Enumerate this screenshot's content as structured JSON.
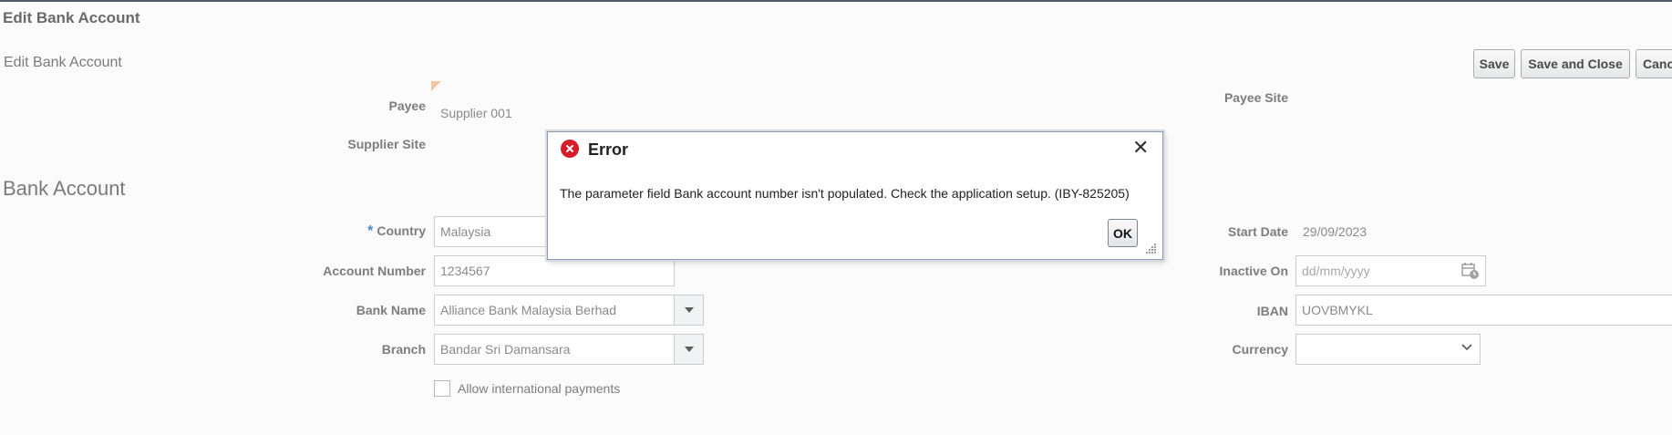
{
  "page": {
    "title": "Edit Bank Account",
    "subtitle": "Edit Bank Account"
  },
  "toolbar": {
    "save_label": "Save",
    "save_close_label": "Save and Close",
    "cancel_label": "Canc"
  },
  "payee": {
    "payee_label": "Payee",
    "payee_value": "Supplier 001",
    "supplier_site_label": "Supplier Site",
    "payee_site_label": "Payee Site"
  },
  "bank_account": {
    "section_title": "Bank Account",
    "required_marker": "*",
    "country_label": "Country",
    "country_value": "Malaysia",
    "account_number_label": "Account Number",
    "account_number_value": "1234567",
    "bank_name_label": "Bank Name",
    "bank_name_value": "Alliance Bank Malaysia Berhad",
    "branch_label": "Branch",
    "branch_value": "Bandar Sri Damansara",
    "allow_international_label": "Allow international payments",
    "start_date_label": "Start Date",
    "start_date_value": "29/09/2023",
    "inactive_on_label": "Inactive On",
    "inactive_on_placeholder": "dd/mm/yyyy",
    "iban_label": "IBAN",
    "iban_value": "UOVBMYKL",
    "currency_label": "Currency",
    "currency_value": ""
  },
  "dialog": {
    "title": "Error",
    "message": "The parameter field Bank account number isn't populated. Check the application setup. (IBY-825205)",
    "ok_label": "OK"
  },
  "icons": {
    "error": "error-circle-icon",
    "close": "close-icon",
    "calendar": "calendar-icon",
    "dropdown": "chevron-down-icon",
    "resize": "resize-grip-icon"
  },
  "colors": {
    "error_red": "#d81d2a",
    "required_blue": "#4b86c4",
    "background": "#fbfbfb"
  }
}
